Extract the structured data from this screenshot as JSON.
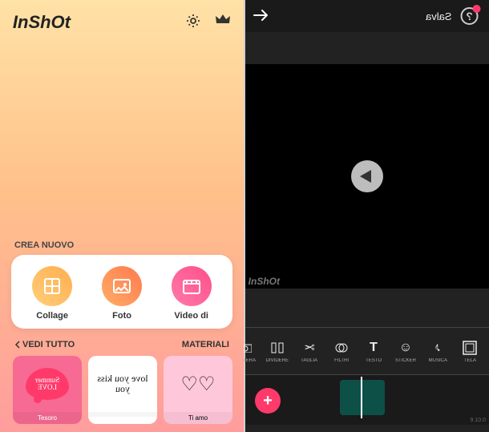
{
  "editor": {
    "back_icon": "arrow",
    "help_icon": "?",
    "save_label": "Salva",
    "watermark": "InShOt",
    "play_icon": "play",
    "tools": [
      {
        "icon": "canvas",
        "label": "TELA"
      },
      {
        "icon": "note",
        "label": "MUSICA"
      },
      {
        "icon": "smile",
        "label": "STICKER"
      },
      {
        "icon": "T",
        "label": "TESTO"
      },
      {
        "icon": "drops",
        "label": "FILTRI"
      },
      {
        "icon": "scissors",
        "label": "TAGLIA"
      },
      {
        "icon": "split",
        "label": "DIVIDERE"
      },
      {
        "icon": "camera",
        "label": "CAMERA"
      }
    ],
    "add_label": "+",
    "version": "9.10.0"
  },
  "home": {
    "logo": "InShOt",
    "settings_icon": "gear",
    "pro_icon": "crown",
    "create_section": "CREA NUOVO",
    "options": [
      {
        "key": "video",
        "label": "Video di"
      },
      {
        "key": "photo",
        "label": "Foto"
      },
      {
        "key": "collage",
        "label": "Collage"
      }
    ],
    "materials_section": "MATERIALI",
    "see_all": "VEDI TUTTO",
    "materials": [
      {
        "caption": "Ti amo",
        "style": "hearts"
      },
      {
        "caption": "",
        "style": "script",
        "text": "love you kiss you"
      },
      {
        "caption": "Tesoro",
        "style": "bubble",
        "text": "Summer LOVE"
      }
    ]
  }
}
